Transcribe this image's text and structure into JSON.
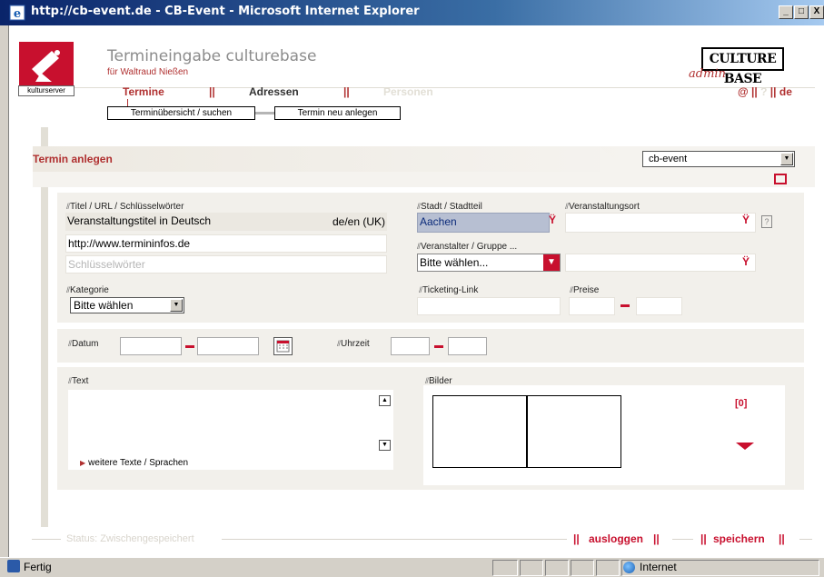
{
  "browser": {
    "title": "http://cb-event.de - CB-Event - Microsoft Internet Explorer",
    "controls": {
      "minimize": "_",
      "maximize": "□",
      "close": "X"
    },
    "status_text": "Fertig",
    "zone_text": "Internet"
  },
  "header": {
    "title": "Termineingabe culturebase",
    "subtitle": "für Waltraud Nießen",
    "logo_label": "kulturserver",
    "brand_logo": "CULTURE BASE",
    "brand_admin": "admin"
  },
  "nav": {
    "termine": "Termine",
    "sep": "||",
    "adressen": "Adressen",
    "personen": "Personen",
    "right_at": "@",
    "right_sep": "||",
    "right_help": "?",
    "right_lang": "de"
  },
  "subnav": {
    "overview": "Terminübersicht / suchen",
    "new": "Termin neu anlegen"
  },
  "panel": {
    "title": "Termin anlegen",
    "db_select": "cb-event"
  },
  "form": {
    "title_label": "Titel / URL / Schlüsselwörter",
    "title_value": "Veranstaltungstitel in Deutsch",
    "title_lang": "de/en (UK)",
    "url_value": "http://www.termininfos.de",
    "keywords_placeholder": "Schlüsselwörter",
    "city_label": "Stadt / Stadtteil",
    "city_value": "Aachen",
    "venue_label": "Veranstaltungsort",
    "help": "?",
    "organizer_label": "Veranstalter / Gruppe ...",
    "organizer_value": "Bitte wählen...",
    "category_label": "Kategorie",
    "category_value": "Bitte wählen",
    "ticketing_label": "Ticketing-Link",
    "price_label": "Preise",
    "date_label": "Datum",
    "time_label": "Uhrzeit",
    "text_label": "Text",
    "more_texts": "weitere Texte / Sprachen",
    "images_label": "Bilder",
    "images_count": "[0]"
  },
  "footer": {
    "status": "Status: Zwischengespeichert",
    "sep": "||",
    "logout": "ausloggen",
    "save": "speichern"
  },
  "colors": {
    "accent_red": "#c8102e",
    "nav_red": "#b03030",
    "panel_beige": "#f2f0eb",
    "title_bar": "#0a246a"
  }
}
